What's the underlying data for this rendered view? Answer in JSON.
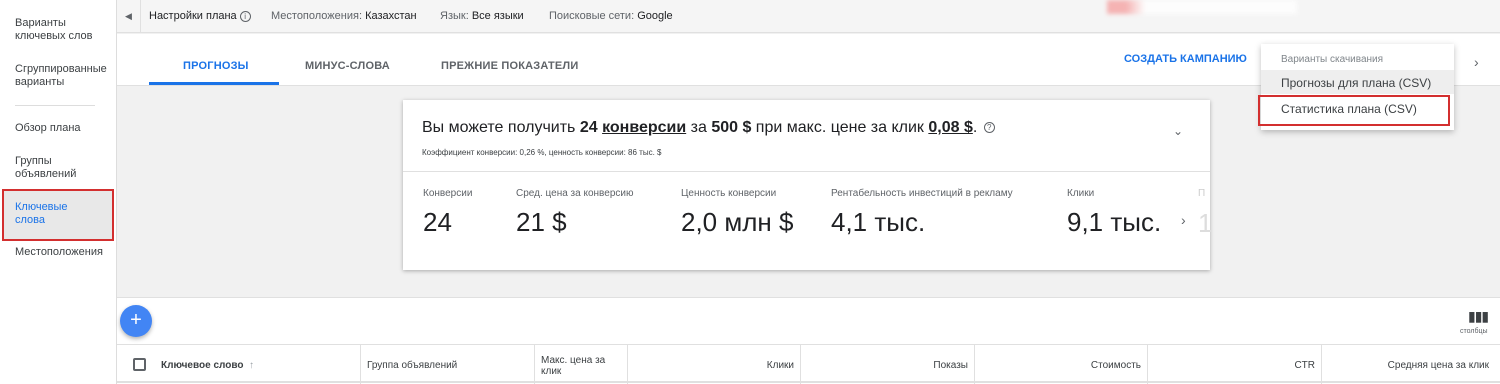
{
  "sidebar": {
    "items": [
      {
        "label": "Варианты ключевых слов"
      },
      {
        "label": "Сгруппированные варианты"
      },
      {
        "label": "Обзор плана"
      },
      {
        "label": "Группы объявлений"
      },
      {
        "label": "Ключевые слова"
      },
      {
        "label": "Местоположения"
      }
    ]
  },
  "topbar": {
    "plan_settings": "Настройки плана",
    "locations_label": "Местоположения:",
    "locations_value": "Казахстан",
    "language_label": "Язык:",
    "language_value": "Все языки",
    "networks_label": "Поисковые сети:",
    "networks_value": "Google"
  },
  "tabs": {
    "items": [
      {
        "label": "ПРОГНОЗЫ",
        "active": true
      },
      {
        "label": "МИНУС-СЛОВА",
        "active": false
      },
      {
        "label": "ПРЕЖНИЕ ПОКАЗАТЕЛИ",
        "active": false
      }
    ],
    "create_campaign": "СОЗДАТЬ КАМПАНИЮ"
  },
  "download_menu": {
    "title": "Варианты скачивания",
    "items": [
      "Прогнозы для плана (CSV)",
      "Статистика плана (CSV)"
    ]
  },
  "summary": {
    "p1": "Вы можете получить ",
    "conversions_count": "24",
    "conversions_word": "конверсии",
    "p2": " за ",
    "budget": "500 $",
    "p3": " при макс. цене за клик ",
    "max_cpc": "0,08 $",
    "p4": ".",
    "sub": "Коэффициент конверсии: 0,26 %, ценность конверсии: 86 тыс. $",
    "metrics": [
      {
        "label": "Конверсии",
        "value": "24"
      },
      {
        "label": "Сред. цена за конверсию",
        "value": "21 $"
      },
      {
        "label": "Ценность конверсии",
        "value": "2,0 млн $"
      },
      {
        "label": "Рентабельность инвестиций в рекламу",
        "value": "4,1 тыс."
      },
      {
        "label": "Клики",
        "value": "9,1 тыс."
      }
    ],
    "faded_label": "П",
    "faded_value": "1"
  },
  "table": {
    "columns_label": "столбцы",
    "headers": [
      "Ключевое слово",
      "Группа объявлений",
      "Макс. цена за клик",
      "Клики",
      "Показы",
      "Стоимость",
      "CTR",
      "Средняя цена за клик"
    ],
    "sort_arrow": "↑"
  },
  "colors": {
    "accent": "#1a73e8",
    "highlight_border": "#d32f2f",
    "fab": "#4285f4"
  }
}
